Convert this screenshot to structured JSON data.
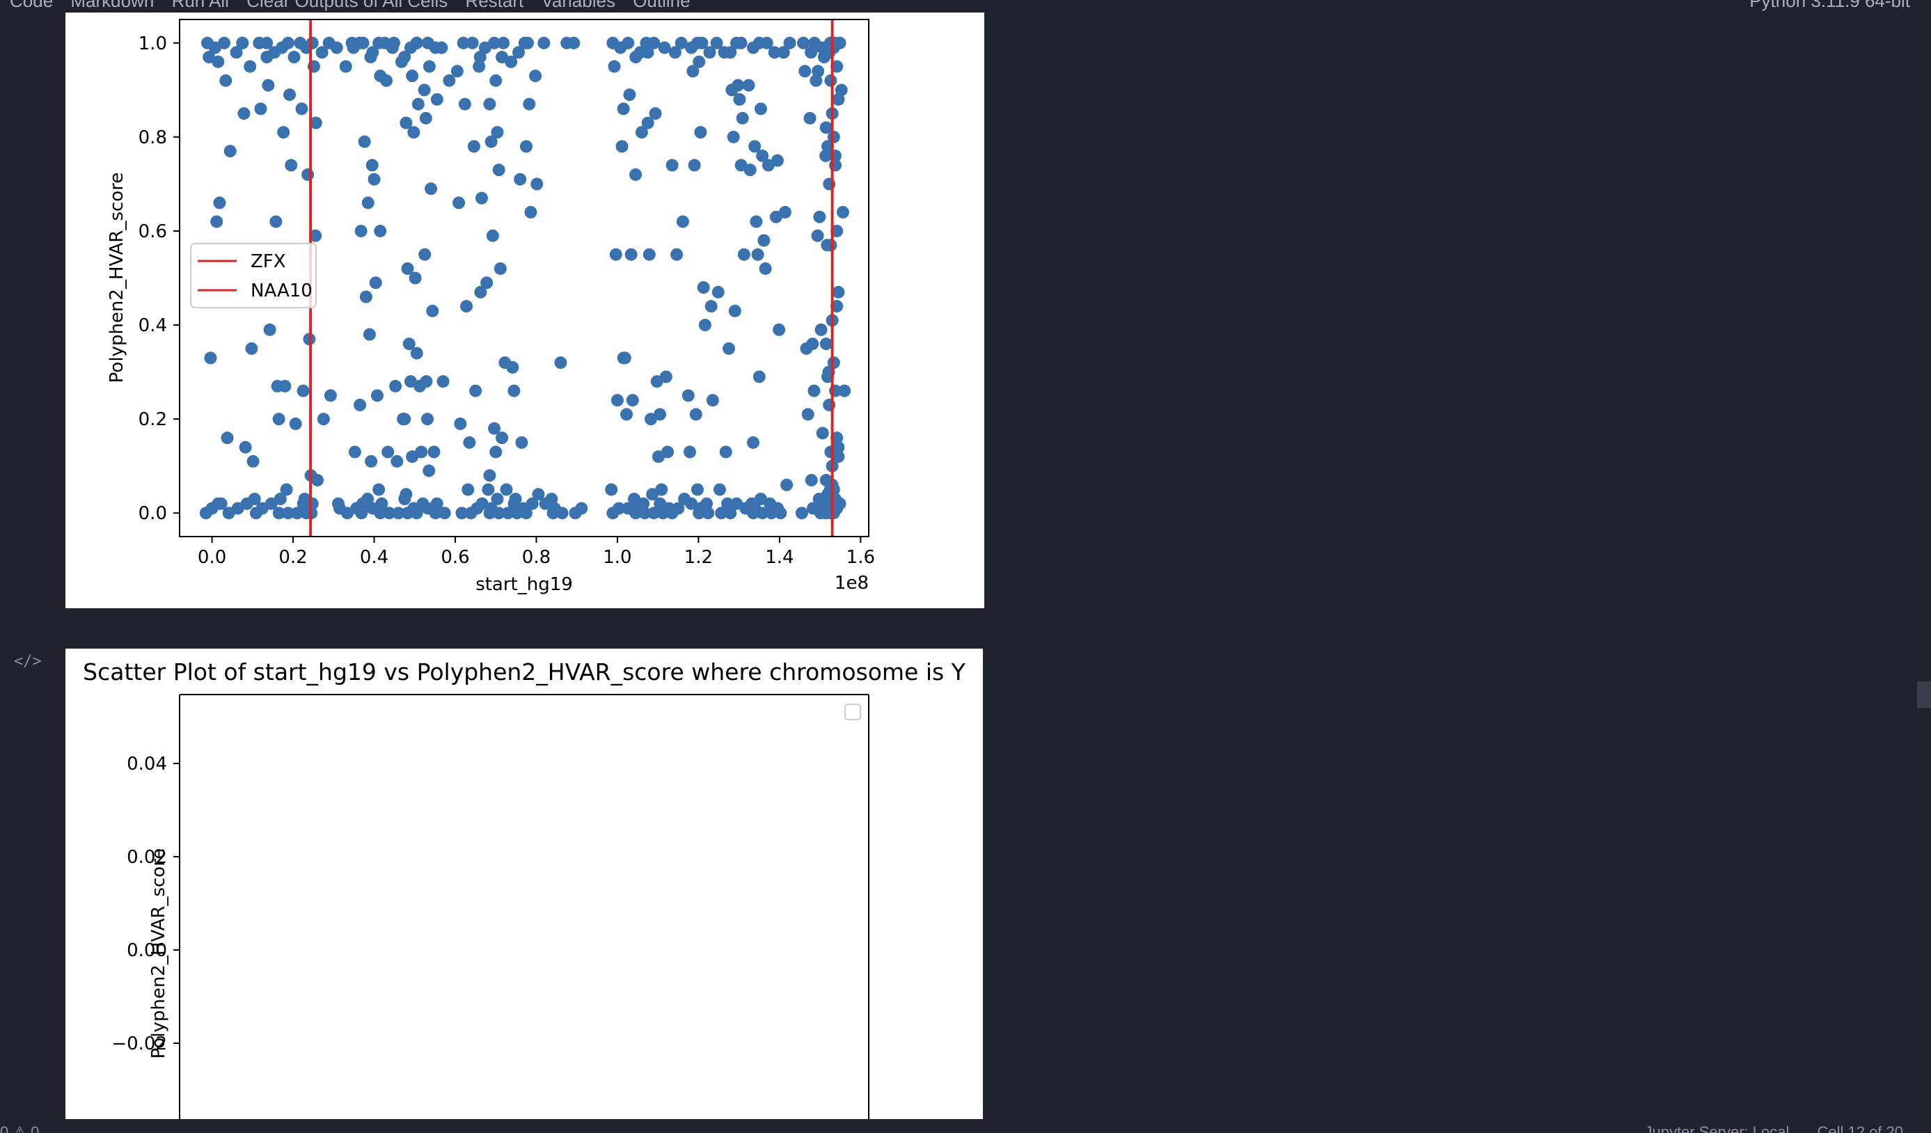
{
  "toolbar": {
    "code_label": "Code",
    "markdown_label": "Markdown",
    "run_all_label": "Run All",
    "clear_outputs_label": "Clear Outputs of All Cells",
    "restart_label": "Restart",
    "variables_label": "Variables",
    "outline_label": "Outline",
    "kernel_label": "Python 3.11.9 64-bit"
  },
  "status": {
    "problems": "0 ⚠ 0",
    "server": "Jupyter Server: Local",
    "cell_position": "Cell 12 of 20"
  },
  "chart_data": [
    {
      "type": "scatter",
      "title": "",
      "xlabel": "start_hg19",
      "ylabel": "Polyphen2_HVAR_score",
      "x_offset_label": "1e8",
      "xticks": [
        "0.0",
        "0.2",
        "0.4",
        "0.6",
        "0.8",
        "1.0",
        "1.2",
        "1.4",
        "1.6"
      ],
      "yticks": [
        "0.0",
        "0.2",
        "0.4",
        "0.6",
        "0.8",
        "1.0"
      ],
      "xlim": [
        -0.08,
        1.62
      ],
      "ylim": [
        -0.05,
        1.05
      ],
      "point_color": "#3a72b0",
      "line_color": "#d62728",
      "vlines": [
        {
          "name": "ZFX",
          "x": 0.243
        },
        {
          "name": "NAA10",
          "x": 1.53
        }
      ],
      "legend": [
        "ZFX",
        "NAA10"
      ],
      "legend_position": "center-left",
      "columns": [
        {
          "x": 0.0,
          "y": [
            0.0,
            0.01,
            0.02,
            0.33,
            0.62,
            0.97,
            0.99,
            1.0
          ]
        },
        {
          "x": 0.03,
          "y": [
            0.0,
            0.02,
            0.16,
            0.66,
            0.92,
            0.96,
            1.0
          ]
        },
        {
          "x": 0.06,
          "y": [
            0.01,
            0.77,
            0.98,
            1.0
          ]
        },
        {
          "x": 0.09,
          "y": [
            0.02,
            0.11,
            0.14,
            0.35,
            0.85,
            0.95,
            1.0
          ]
        },
        {
          "x": 0.12,
          "y": [
            0.0,
            0.01,
            0.03,
            0.86,
            0.97,
            1.0
          ]
        },
        {
          "x": 0.15,
          "y": [
            0.0,
            0.02,
            0.27,
            0.39,
            0.62,
            0.91,
            0.98,
            1.0
          ]
        },
        {
          "x": 0.18,
          "y": [
            0.0,
            0.03,
            0.05,
            0.2,
            0.27,
            0.74,
            0.81,
            0.89,
            0.99,
            1.0
          ]
        },
        {
          "x": 0.21,
          "y": [
            0.0,
            0.02,
            0.19,
            0.86,
            0.97,
            1.0
          ]
        },
        {
          "x": 0.24,
          "y": [
            0.0,
            0.02,
            0.03,
            0.08,
            0.26,
            0.37,
            0.59,
            0.72,
            0.95,
            0.99,
            1.0
          ]
        },
        {
          "x": 0.26,
          "y": [
            0.0,
            0.07,
            0.2,
            0.83,
            0.98
          ]
        },
        {
          "x": 0.3,
          "y": [
            0.02,
            0.25,
            0.99,
            1.0
          ]
        },
        {
          "x": 0.33,
          "y": [
            0.0,
            0.01,
            0.95,
            1.0
          ]
        },
        {
          "x": 0.36,
          "y": [
            0.01,
            0.02,
            0.13,
            0.6,
            0.99,
            1.0
          ]
        },
        {
          "x": 0.38,
          "y": [
            0.0,
            0.03,
            0.23,
            0.46,
            0.74,
            0.79,
            0.97,
            1.0
          ]
        },
        {
          "x": 0.4,
          "y": [
            0.0,
            0.01,
            0.05,
            0.11,
            0.25,
            0.38,
            0.49,
            0.66,
            0.71,
            0.93,
            0.98,
            1.0
          ]
        },
        {
          "x": 0.43,
          "y": [
            0.0,
            0.02,
            0.13,
            0.6,
            0.92,
            0.99,
            1.0
          ]
        },
        {
          "x": 0.46,
          "y": [
            0.0,
            0.03,
            0.11,
            0.2,
            0.27,
            0.96,
            1.0
          ]
        },
        {
          "x": 0.49,
          "y": [
            0.0,
            0.01,
            0.04,
            0.12,
            0.2,
            0.28,
            0.34,
            0.36,
            0.5,
            0.52,
            0.81,
            0.83,
            0.93,
            0.97,
            0.99,
            1.0
          ]
        },
        {
          "x": 0.52,
          "y": [
            0.0,
            0.02,
            0.09,
            0.13,
            0.2,
            0.27,
            0.84,
            0.87,
            0.9,
            1.0
          ]
        },
        {
          "x": 0.54,
          "y": [
            0.0,
            0.01,
            0.13,
            0.28,
            0.43,
            0.55,
            0.69,
            0.88,
            0.95,
            0.99,
            1.0
          ]
        },
        {
          "x": 0.57,
          "y": [
            0.0,
            0.02,
            0.28,
            0.92,
            0.99
          ]
        },
        {
          "x": 0.62,
          "y": [
            0.0,
            0.05,
            0.19,
            0.44,
            0.66,
            0.87,
            0.94,
            1.0
          ]
        },
        {
          "x": 0.65,
          "y": [
            0.0,
            0.01,
            0.15,
            0.26,
            0.67,
            0.78,
            0.97,
            1.0
          ]
        },
        {
          "x": 0.67,
          "y": [
            0.0,
            0.02,
            0.05,
            0.47,
            0.49,
            0.95,
            0.99
          ]
        },
        {
          "x": 0.7,
          "y": [
            0.0,
            0.01,
            0.03,
            0.08,
            0.13,
            0.16,
            0.18,
            0.52,
            0.59,
            0.73,
            0.79,
            0.81,
            0.87,
            0.92,
            0.97,
            1.0
          ]
        },
        {
          "x": 0.73,
          "y": [
            0.0,
            0.02,
            0.05,
            0.31,
            0.32,
            0.96,
            1.0
          ]
        },
        {
          "x": 0.76,
          "y": [
            0.0,
            0.01,
            0.03,
            0.15,
            0.26,
            0.71,
            0.78,
            0.98,
            1.0
          ]
        },
        {
          "x": 0.79,
          "y": [
            0.0,
            0.02,
            0.04,
            0.64,
            0.7,
            0.87,
            0.93,
            1.0
          ]
        },
        {
          "x": 0.83,
          "y": [
            0.0,
            0.02,
            0.03,
            1.0
          ]
        },
        {
          "x": 0.86,
          "y": [
            0.0,
            0.01,
            0.32,
            1.0
          ]
        },
        {
          "x": 0.9,
          "y": [
            0.0,
            0.01,
            1.0
          ]
        },
        {
          "x": 1.0,
          "y": [
            0.0,
            0.01,
            0.05,
            0.24,
            0.33,
            0.55,
            0.78,
            0.95,
            0.99,
            1.0
          ]
        },
        {
          "x": 1.03,
          "y": [
            0.0,
            0.01,
            0.03,
            0.21,
            0.24,
            0.33,
            0.55,
            0.86,
            0.89,
            0.97,
            1.0
          ]
        },
        {
          "x": 1.06,
          "y": [
            0.0,
            0.01,
            0.02,
            0.72,
            0.81,
            0.83,
            0.98,
            1.0
          ]
        },
        {
          "x": 1.09,
          "y": [
            0.0,
            0.02,
            0.04,
            0.12,
            0.2,
            0.28,
            0.55,
            0.85,
            0.98,
            1.0
          ]
        },
        {
          "x": 1.12,
          "y": [
            0.0,
            0.01,
            0.05,
            0.13,
            0.21,
            0.29,
            0.74,
            0.99
          ]
        },
        {
          "x": 1.15,
          "y": [
            0.0,
            0.01,
            0.03,
            0.55,
            0.62,
            0.98,
            1.0
          ]
        },
        {
          "x": 1.19,
          "y": [
            0.0,
            0.02,
            0.05,
            0.13,
            0.21,
            0.25,
            0.74,
            0.81,
            0.94,
            0.96,
            0.99,
            1.0
          ]
        },
        {
          "x": 1.22,
          "y": [
            0.0,
            0.01,
            0.02,
            0.24,
            0.4,
            0.44,
            0.48,
            0.98,
            1.0
          ]
        },
        {
          "x": 1.26,
          "y": [
            0.0,
            0.02,
            0.05,
            0.13,
            0.47,
            0.98,
            1.0
          ]
        },
        {
          "x": 1.29,
          "y": [
            0.0,
            0.02,
            0.35,
            0.43,
            0.74,
            0.8,
            0.88,
            0.9,
            0.91,
            0.98,
            1.0
          ]
        },
        {
          "x": 1.32,
          "y": [
            0.0,
            0.01,
            0.02,
            0.55,
            0.73,
            0.84,
            0.91,
            1.0
          ]
        },
        {
          "x": 1.35,
          "y": [
            0.0,
            0.01,
            0.03,
            0.15,
            0.29,
            0.52,
            0.55,
            0.58,
            0.62,
            0.76,
            0.78,
            0.86,
            0.99,
            1.0
          ]
        },
        {
          "x": 1.38,
          "y": [
            0.0,
            0.01,
            0.02,
            0.63,
            0.74,
            0.98,
            1.0
          ]
        },
        {
          "x": 1.41,
          "y": [
            0.0,
            0.06,
            0.39,
            0.64,
            0.75,
            0.98,
            1.0
          ]
        },
        {
          "x": 1.47,
          "y": [
            0.0,
            0.21,
            0.26,
            0.35,
            0.36,
            0.94,
            0.98,
            1.0
          ]
        },
        {
          "x": 1.49,
          "y": [
            0.0,
            0.01,
            0.03,
            0.07,
            0.59,
            0.84,
            0.92,
            0.99,
            1.0
          ]
        },
        {
          "x": 1.51,
          "y": [
            0.0,
            0.01,
            0.03,
            0.05,
            0.17,
            0.3,
            0.39,
            0.57,
            0.63,
            0.76,
            0.94,
            0.97,
            1.0
          ]
        },
        {
          "x": 1.53,
          "y": [
            0.0,
            0.01,
            0.02,
            0.03,
            0.04,
            0.05,
            0.07,
            0.1,
            0.12,
            0.13,
            0.16,
            0.23,
            0.26,
            0.29,
            0.32,
            0.36,
            0.41,
            0.47,
            0.57,
            0.6,
            0.7,
            0.74,
            0.78,
            0.8,
            0.82,
            0.85,
            0.88,
            0.92,
            0.95,
            0.98,
            1.0
          ]
        },
        {
          "x": 1.545,
          "y": [
            0.0,
            0.02,
            0.06,
            0.14,
            0.26,
            0.44,
            0.64,
            0.76,
            0.9,
            0.99,
            1.0
          ]
        }
      ]
    },
    {
      "type": "scatter",
      "title": "Scatter Plot of start_hg19 vs Polyphen2_HVAR_score where chromosome is Y",
      "xlabel": "",
      "ylabel": "Polyphen2_HVAR_score",
      "yticks": [
        "0.04",
        "0.02",
        "0.00",
        "−0.02"
      ],
      "ylim": [
        -0.055,
        0.055
      ],
      "empty": true,
      "legend": []
    }
  ]
}
